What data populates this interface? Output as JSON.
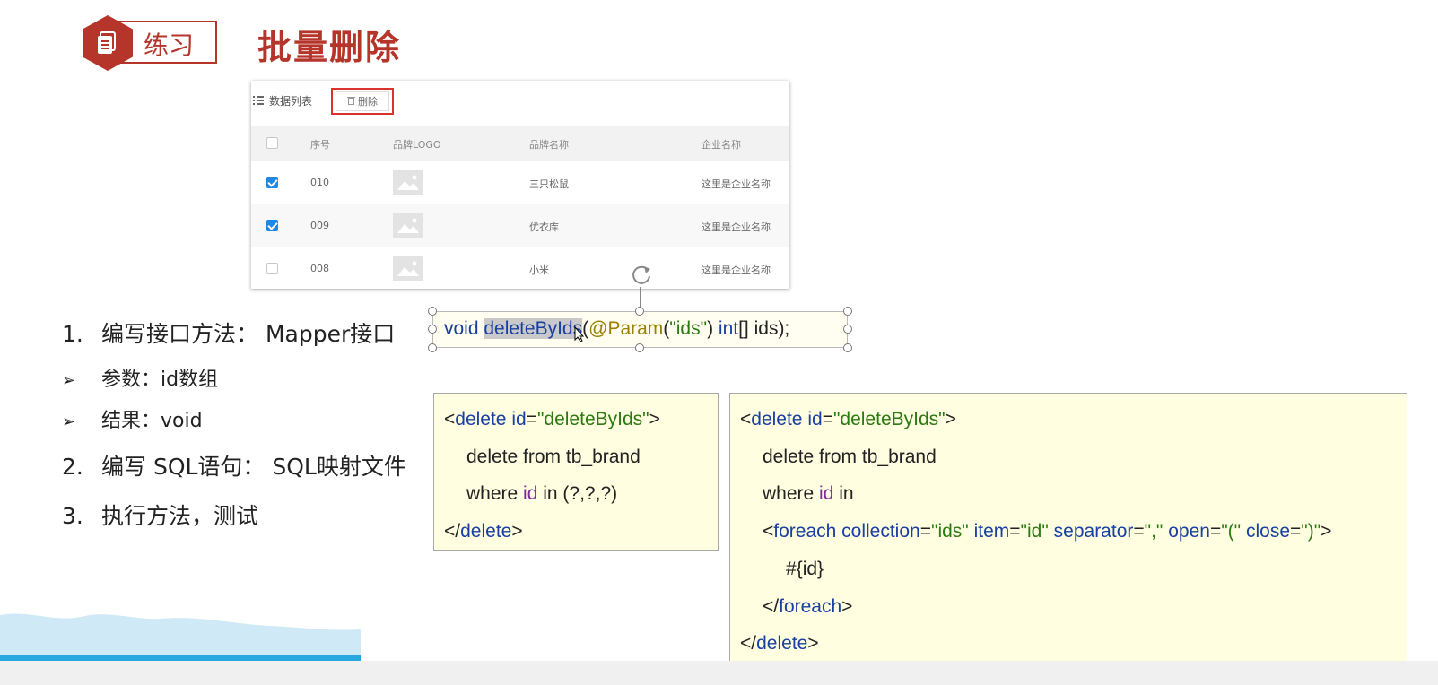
{
  "header": {
    "badge_label": "练习",
    "title": "批量删除"
  },
  "panel": {
    "list_title": "数据列表",
    "delete_button": "删除",
    "columns": [
      "序号",
      "品牌LOGO",
      "品牌名称",
      "企业名称"
    ],
    "rows": [
      {
        "checked": true,
        "id": "010",
        "brand": "三只松鼠",
        "company": "这里是企业名称"
      },
      {
        "checked": true,
        "id": "009",
        "brand": "优衣库",
        "company": "这里是企业名称"
      },
      {
        "checked": false,
        "id": "008",
        "brand": "小米",
        "company": "这里是企业名称"
      }
    ]
  },
  "steps": [
    {
      "num": "1.",
      "text": "编写接口方法： Mapper接口"
    },
    {
      "arrow": "➢",
      "text": "参数：id数组"
    },
    {
      "arrow": "➢",
      "text": "结果：void"
    },
    {
      "num": "2.",
      "text": "编写 SQL语句： SQL映射文件"
    },
    {
      "num": "3.",
      "text": "执行方法，测试"
    }
  ],
  "signature": {
    "void": "void",
    "method": "deleteByIds",
    "paren_open": "(",
    "annotation": "@Param",
    "p1": "(",
    "q1": "\"ids\"",
    "p2": ")",
    "type": "int",
    "rest": "[] ids);"
  },
  "box1": {
    "open_lt": "<",
    "tag": "delete",
    "attr": "id",
    "eq": "=",
    "val": "\"deleteByIds\"",
    "gt": ">",
    "line2": "delete from tb_brand",
    "where": "where",
    "idword": "id",
    "tail": "in (?,?,?)",
    "close_lt": "</",
    "close_tag": "delete",
    "close_gt": ">"
  },
  "box2": {
    "open_lt": "<",
    "tag": "delete",
    "attr": "id",
    "eq": "=",
    "val": "\"deleteByIds\"",
    "gt": ">",
    "line2": "delete from tb_brand",
    "where": "where",
    "idword": "id",
    "in": "in",
    "fe_lt": "<",
    "fe_tag": "foreach",
    "a_collection": "collection",
    "v_collection": "\"ids\"",
    "a_item": "item",
    "v_item": "\"id\"",
    "a_sep": "separator",
    "v_sep": "\",\"",
    "a_open": "open",
    "v_open": "\"(\"",
    "a_close": "close",
    "v_close": "\")\"",
    "fe_gt": ">",
    "placeholder": "#{id}",
    "fe_close_lt": "</",
    "fe_close_tag": "foreach",
    "fe_close_gt": ">",
    "close_lt": "</",
    "close_tag": "delete",
    "close_gt": ">"
  },
  "colors": {
    "accent": "#b5352a",
    "keyword": "#1a3fa3",
    "string": "#2c7a12",
    "annotation": "#9a8100",
    "property": "#7a2a9a",
    "checkbox": "#1e88e5"
  }
}
